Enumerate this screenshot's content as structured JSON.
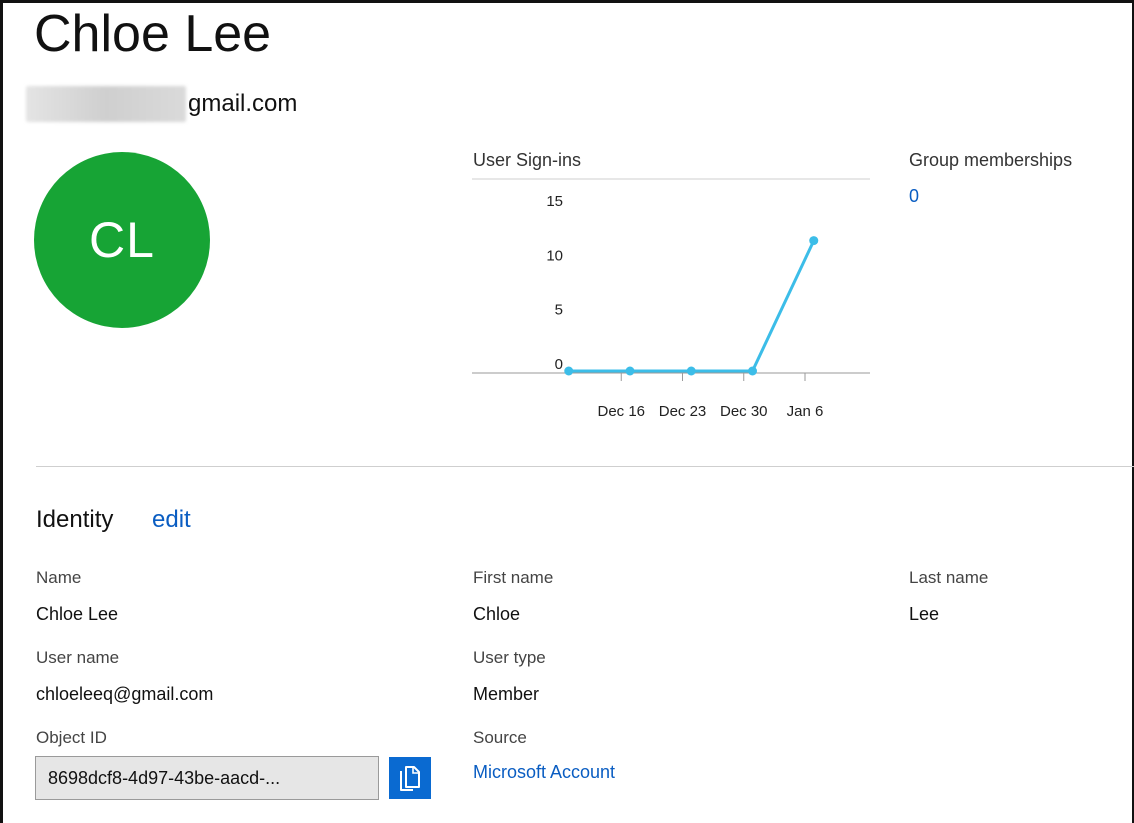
{
  "user": {
    "display_name": "Chloe Lee",
    "email_visible_part": "gmail.com",
    "initials": "CL"
  },
  "sign_ins": {
    "title": "User Sign-ins"
  },
  "chart_data": {
    "type": "line",
    "title": "User Sign-ins",
    "x_tick_labels": [
      "Dec 16",
      "Dec 23",
      "Dec 30",
      "Jan 6"
    ],
    "y_tick_labels": [
      "15",
      "10",
      "5",
      "0"
    ],
    "y_ticks": [
      15,
      10,
      5,
      0
    ],
    "ylim": [
      0,
      15
    ],
    "series": [
      {
        "points": [
          {
            "x": "Dec 10",
            "y": 0
          },
          {
            "x": "Dec 17",
            "y": 0
          },
          {
            "x": "Dec 24",
            "y": 0
          },
          {
            "x": "Dec 31",
            "y": 0
          },
          {
            "x": "Jan 7",
            "y": 12
          }
        ]
      }
    ],
    "line_color": "#3cbde8",
    "grid": false
  },
  "groups": {
    "title": "Group memberships",
    "count": "0"
  },
  "identity": {
    "heading": "Identity",
    "edit_label": "edit",
    "fields": {
      "name_label": "Name",
      "name_value": "Chloe Lee",
      "first_name_label": "First name",
      "first_name_value": "Chloe",
      "last_name_label": "Last name",
      "last_name_value": "Lee",
      "user_name_label": "User name",
      "user_name_value": "chloeleeq@gmail.com",
      "user_type_label": "User type",
      "user_type_value": "Member",
      "object_id_label": "Object ID",
      "object_id_value": "8698dcf8-4d97-43be-aacd-...",
      "source_label": "Source",
      "source_value": "Microsoft Account"
    }
  },
  "icons": {
    "copy": "copy-icon"
  },
  "colors": {
    "avatar": "#17a435",
    "link": "#0a5dc2",
    "copy_button": "#0a6ad1",
    "chart_line": "#3cbde8"
  }
}
